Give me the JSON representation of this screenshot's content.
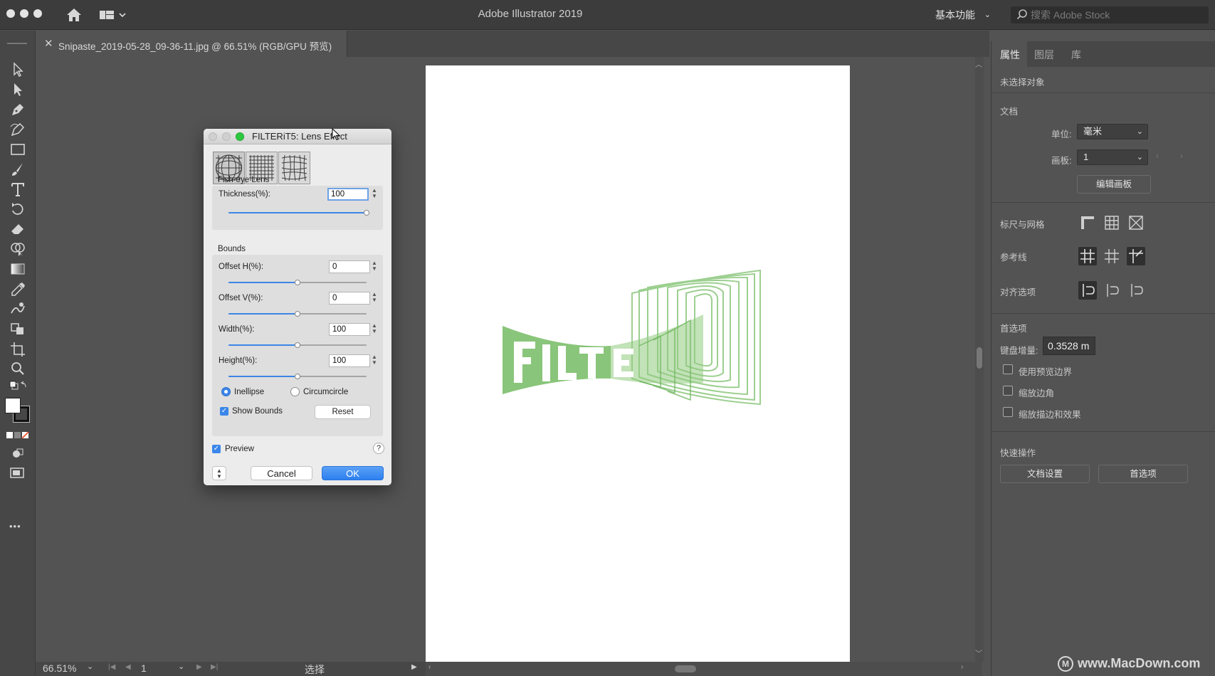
{
  "window": {
    "title": "Adobe Illustrator 2019"
  },
  "topbar": {
    "workspace_label": "基本功能",
    "stock_search_placeholder": "搜索 Adobe Stock"
  },
  "document_tab": {
    "close_glyph": "✕",
    "title": "Snipaste_2019-05-28_09-36-11.jpg @ 66.51% (RGB/GPU 预览)"
  },
  "toolbar": {
    "tools": [
      "selection-tool",
      "direct-selection-tool",
      "pen-tool",
      "curvature-tool",
      "rectangle-tool",
      "paintbrush-tool",
      "type-tool",
      "rotate-tool",
      "eraser-tool",
      "shape-builder-tool",
      "gradient-tool",
      "eyedropper-tool",
      "warp-tool",
      "free-transform-tool",
      "artboard-tool",
      "zoom-tool"
    ],
    "more_glyph": "•••"
  },
  "artwork": {
    "text": "FILTE",
    "color": "#6cb45a"
  },
  "statusbar": {
    "zoom": "66.51%",
    "artboard_number": "1",
    "mode": "选择"
  },
  "right_panel": {
    "tabs": [
      "属性",
      "图层",
      "库"
    ],
    "no_selection": "未选择对象",
    "document_section": "文档",
    "unit_label": "单位:",
    "unit_value": "毫米",
    "artboard_label": "画板:",
    "artboard_value": "1",
    "edit_artboards_button": "编辑画板",
    "rulers_grids_label": "标尺与网格",
    "guides_label": "参考线",
    "snap_options_label": "对齐选项",
    "preferences_section": "首选项",
    "keyboard_increment_label": "键盘增量:",
    "keyboard_increment_value": "0.3528 m",
    "checkboxes": [
      "使用预览边界",
      "缩放边角",
      "缩放描边和效果"
    ],
    "quick_actions_section": "快速操作",
    "doc_setup_button": "文档设置",
    "preferences_button": "首选项"
  },
  "dialog": {
    "title": "FILTERiT5: Lens Effect",
    "fisheye_section": "Fish-eye Lens",
    "thickness_label": "Thickness(%):",
    "thickness_value": "100",
    "thickness_level": 1.0,
    "bounds_section": "Bounds",
    "offset_h_label": "Offset H(%):",
    "offset_h_value": "0",
    "offset_h_level": 0.5,
    "offset_v_label": "Offset V(%):",
    "offset_v_value": "0",
    "offset_v_level": 0.5,
    "width_label": "Width(%):",
    "width_value": "100",
    "width_level": 0.5,
    "height_label": "Height(%):",
    "height_value": "100",
    "height_level": 0.5,
    "inellipse_label": "Inellipse",
    "circumcircle_label": "Circumcircle",
    "show_bounds_label": "Show Bounds",
    "reset_button": "Reset",
    "preview_label": "Preview",
    "help_glyph": "?",
    "cancel_button": "Cancel",
    "ok_button": "OK"
  },
  "watermark": "www.MacDown.com",
  "colors": {
    "accent": "#2d7ff0",
    "panel": "#535353",
    "dark": "#3c3c3c"
  }
}
